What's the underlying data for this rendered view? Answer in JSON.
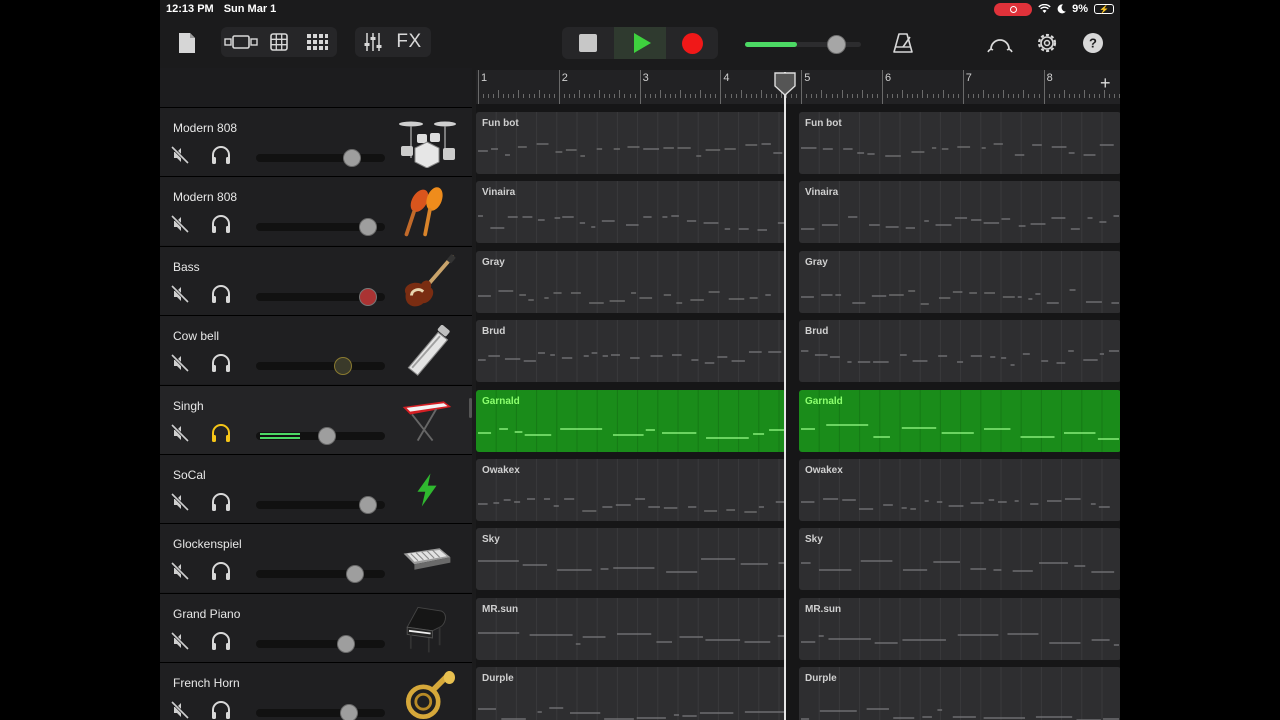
{
  "status": {
    "time": "12:13 PM",
    "date": "Sun Mar 1",
    "battery": "9%"
  },
  "toolbar": {
    "fx_label": "FX"
  },
  "master_volume": 0.85,
  "playhead_bar": 4.8,
  "ruler": {
    "bars": [
      "1",
      "2",
      "3",
      "4",
      "5",
      "6",
      "7",
      "8"
    ]
  },
  "tracks": [
    {
      "name": "Modern 808",
      "instrument": "drum-kit-icon",
      "volume": 0.78,
      "soloed": false,
      "regions": [
        "Fun bot",
        "Fun bot"
      ]
    },
    {
      "name": "Modern 808",
      "instrument": "maracas-icon",
      "volume": 0.93,
      "soloed": false,
      "regions": [
        "Vinaira",
        "Vinaira"
      ]
    },
    {
      "name": "Bass",
      "instrument": "bass-guitar-icon",
      "volume": 0.93,
      "soloed": false,
      "regions": [
        "Gray",
        "Gray"
      ]
    },
    {
      "name": "Cow bell",
      "instrument": "cowbell-icon",
      "volume": 0.7,
      "soloed": false,
      "regions": [
        "Brud",
        "Brud"
      ]
    },
    {
      "name": "Singh",
      "instrument": "keyboard-synth-icon",
      "volume": 0.56,
      "soloed": true,
      "regions": [
        "Garnald",
        "Garnald"
      ]
    },
    {
      "name": "SoCal",
      "instrument": "lightning-bolt-icon",
      "volume": 0.93,
      "soloed": false,
      "regions": [
        "Owakex",
        "Owakex"
      ]
    },
    {
      "name": "Glockenspiel",
      "instrument": "glockenspiel-icon",
      "volume": 0.81,
      "soloed": false,
      "regions": [
        "Sky",
        "Sky"
      ]
    },
    {
      "name": "Grand Piano",
      "instrument": "grand-piano-icon",
      "volume": 0.73,
      "soloed": false,
      "regions": [
        "MR.sun",
        "MR.sun"
      ]
    },
    {
      "name": "French Horn",
      "instrument": "french-horn-icon",
      "volume": 0.76,
      "soloed": false,
      "regions": [
        "Durple",
        "Durple"
      ]
    }
  ],
  "colors": {
    "accent_green": "#4cd964",
    "play_green": "#3ed13e",
    "record_red": "#f01818",
    "selected_region": "#1a8c1a",
    "solo_yellow": "#f5c518"
  }
}
